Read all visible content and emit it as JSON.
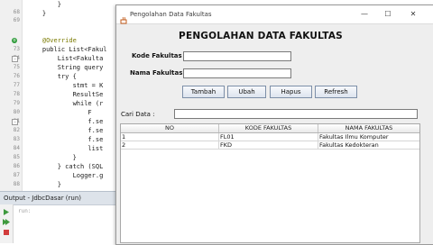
{
  "editor": {
    "line_numbers": [
      "",
      "68",
      "69",
      "",
      "73",
      "74",
      "75",
      "76",
      "77",
      "78",
      "79",
      "80",
      "81",
      "82",
      "83",
      "84",
      "85",
      "86",
      "87",
      "88",
      "89",
      "90"
    ],
    "lines": [
      {
        "text": "        }",
        "kind": "plain"
      },
      {
        "text": "    }",
        "kind": "plain"
      },
      {
        "text": "",
        "kind": "plain"
      },
      {
        "text": "    @Override",
        "kind": "ann"
      },
      {
        "text": "    public List<Fakul",
        "kind": "plain"
      },
      {
        "text": "        List<Fakulta",
        "kind": "plain"
      },
      {
        "text": "        String query",
        "kind": "plain"
      },
      {
        "text": "        try {",
        "kind": "plain"
      },
      {
        "text": "            stmt = K",
        "kind": "plain"
      },
      {
        "text": "            ResultSe",
        "kind": "plain"
      },
      {
        "text": "            while (r",
        "kind": "plain"
      },
      {
        "text": "                F",
        "kind": "plain"
      },
      {
        "text": "                f.se",
        "kind": "plain"
      },
      {
        "text": "                f.se",
        "kind": "plain"
      },
      {
        "text": "                f.se",
        "kind": "plain"
      },
      {
        "text": "                list",
        "kind": "plain"
      },
      {
        "text": "            }",
        "kind": "plain"
      },
      {
        "text": "        } catch (SQL",
        "kind": "plain"
      },
      {
        "text": "            Logger.g",
        "kind": "plain"
      },
      {
        "text": "        }",
        "kind": "plain"
      },
      {
        "text": "        return list;",
        "kind": "plain"
      },
      {
        "text": "    }",
        "kind": "plain"
      }
    ]
  },
  "output": {
    "title": "Output - JdbcDasar (run)",
    "text": "run:"
  },
  "dialog": {
    "window_title": "Pengolahan Data Fakultas",
    "heading": "PENGOLAHAN DATA FAKULTAS",
    "kode_label": "Kode Fakultas :",
    "kode_value": "",
    "nama_label": "Nama Fakultas :",
    "nama_value": "",
    "buttons": {
      "tambah": "Tambah",
      "ubah": "Ubah",
      "hapus": "Hapus",
      "refresh": "Refresh"
    },
    "cari_label": "Cari Data :",
    "cari_value": "",
    "table": {
      "headers": [
        "NO",
        "KODE FAKULTAS",
        "NAMA FAKULTAS"
      ],
      "rows": [
        [
          "1",
          "FL01",
          "Fakultas Ilmu Komputer"
        ],
        [
          "2",
          "FKD",
          "Fakultas Kedokteran"
        ]
      ]
    }
  },
  "colors": {
    "ide_keyword": "#0000b0",
    "dialog_bg": "#eeeeee",
    "button_border": "#7d8fa8"
  }
}
